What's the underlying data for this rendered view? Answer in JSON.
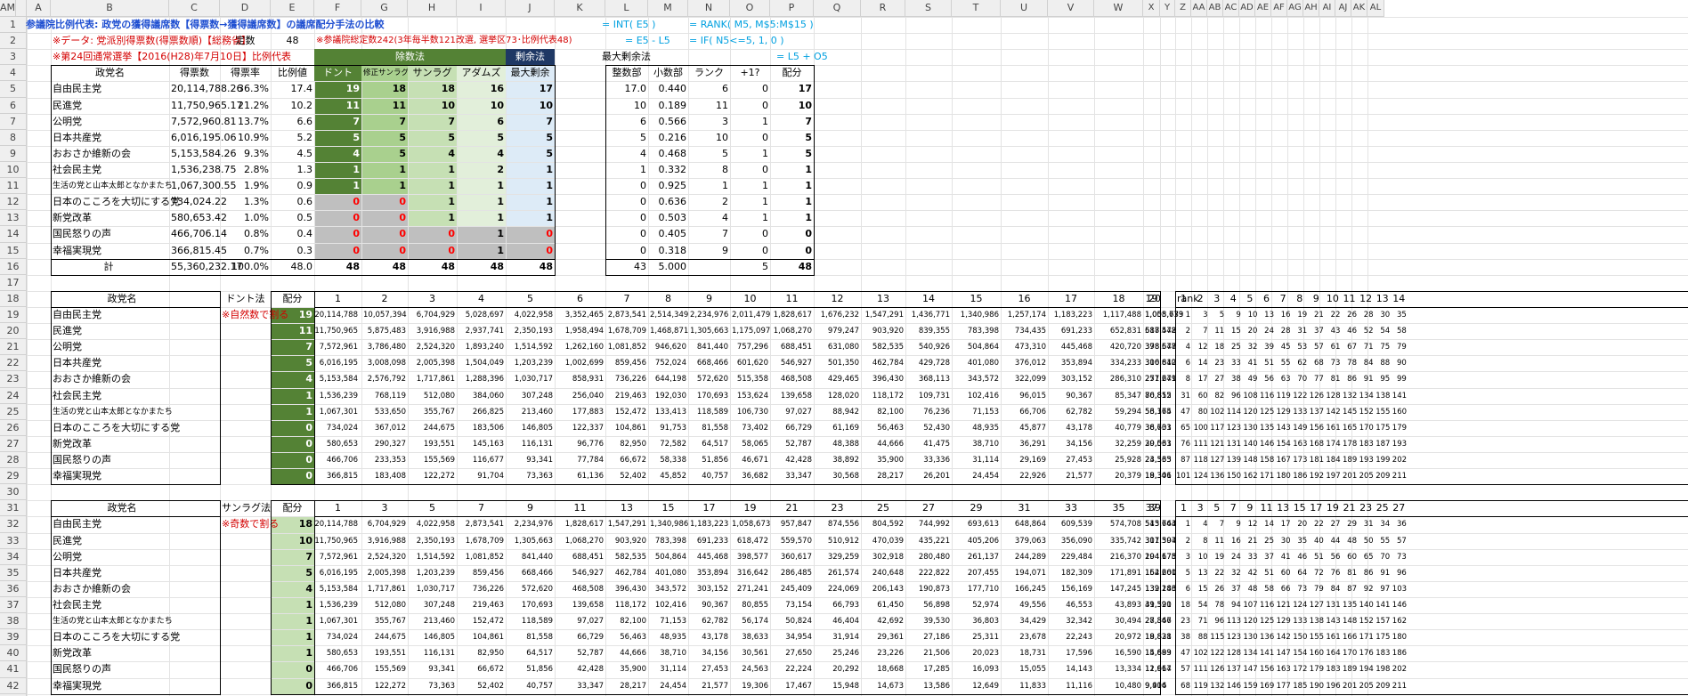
{
  "cols": [
    "A",
    "B",
    "C",
    "D",
    "E",
    "F",
    "G",
    "H",
    "I",
    "J",
    "K",
    "L",
    "M",
    "N",
    "O",
    "P",
    "Q",
    "R",
    "S",
    "T",
    "U",
    "V",
    "W",
    "X",
    "Y",
    "Z",
    "AA",
    "AB",
    "AC",
    "AD",
    "AE",
    "AF",
    "AG",
    "AH",
    "AI",
    "AJ",
    "AK",
    "AL",
    "AM"
  ],
  "title": "参議院比例代表: 政党の獲得議席数【得票数→獲得議席数】の議席配分手法の比較",
  "formula1": "= INT( E5 )",
  "formula2": "= RANK( M5, M$5:M$15 )",
  "formula3": "= E5 - L5",
  "formula4": "= IF( N5<=5, 1, 0 )",
  "formula5": "= L5 + O5",
  "note_data": "※データ: 党派別得票数(得票数順)【総務省】",
  "note_election": "※第24回通常選挙【2016(H28)年7月10日】比例代表",
  "note_seats": "※参議院総定数242(3年毎半数121改選, 選挙区73･比例代表48)",
  "label_teisu": "定数",
  "teisu": "48",
  "label_jyosu": "除数法",
  "label_jouyo": "剰余法",
  "label_saidai": "最大剰余法",
  "head1": [
    "政党名",
    "得票数",
    "得票率",
    "比例値",
    "ドント",
    "修正サンラグ",
    "サンラグ",
    "アダムズ",
    "最大剰余"
  ],
  "head2": [
    "整数部",
    "小数部",
    "ランク",
    "+1?",
    "配分"
  ],
  "parties": [
    "自由民主党",
    "民進党",
    "公明党",
    "日本共産党",
    "おおさか維新の会",
    "社会民主党",
    "生活の党と山本太郎となかまたち",
    "日本のこころを大切にする党",
    "新党改革",
    "国民怒りの声",
    "幸福実現党"
  ],
  "votes": [
    "20,114,788.26",
    "11,750,965.17",
    "7,572,960.81",
    "6,016,195.06",
    "5,153,584.26",
    "1,536,238.75",
    "1,067,300.55",
    "734,024.22",
    "580,653.42",
    "466,706.14",
    "366,815.45"
  ],
  "rate": [
    "36.3%",
    "21.2%",
    "13.7%",
    "10.9%",
    "9.3%",
    "2.8%",
    "1.9%",
    "1.3%",
    "1.0%",
    "0.8%",
    "0.7%"
  ],
  "hirei": [
    "17.4",
    "10.2",
    "6.6",
    "5.2",
    "4.5",
    "1.3",
    "0.9",
    "0.6",
    "0.5",
    "0.4",
    "0.3"
  ],
  "m_dhondt": [
    "19",
    "11",
    "7",
    "5",
    "4",
    "1",
    "1",
    "0",
    "0",
    "0",
    "0"
  ],
  "m_modsl": [
    "18",
    "11",
    "7",
    "5",
    "5",
    "1",
    "1",
    "0",
    "0",
    "0",
    "0"
  ],
  "m_sl": [
    "18",
    "10",
    "7",
    "5",
    "4",
    "1",
    "1",
    "1",
    "1",
    "0",
    "0"
  ],
  "m_adams": [
    "16",
    "10",
    "6",
    "5",
    "4",
    "2",
    "1",
    "1",
    "1",
    "1",
    "1"
  ],
  "m_lr": [
    "17",
    "10",
    "7",
    "5",
    "5",
    "1",
    "1",
    "1",
    "1",
    "0",
    "0"
  ],
  "lr_int": [
    "17.0",
    "10",
    "6",
    "5",
    "4",
    "1",
    "0",
    "0",
    "0",
    "0",
    "0"
  ],
  "lr_frac": [
    "0.440",
    "0.189",
    "0.566",
    "0.216",
    "0.468",
    "0.332",
    "0.925",
    "0.636",
    "0.503",
    "0.405",
    "0.318"
  ],
  "lr_rank": [
    "6",
    "11",
    "3",
    "10",
    "5",
    "8",
    "1",
    "2",
    "4",
    "7",
    "9"
  ],
  "lr_plus": [
    "0",
    "0",
    "1",
    "0",
    "1",
    "0",
    "1",
    "1",
    "1",
    "0",
    "0"
  ],
  "lr_alloc": [
    "17",
    "10",
    "7",
    "5",
    "5",
    "1",
    "1",
    "1",
    "1",
    "0",
    "0"
  ],
  "totals": {
    "label": "計",
    "votes": "55,360,232.17",
    "rate": "100.0%",
    "hirei": "48.0",
    "d": "48",
    "ms": "48",
    "s": "48",
    "a": "48",
    "lr": "48",
    "int": "43",
    "frac": "5.000",
    "plus": "5",
    "alloc": "48"
  },
  "sec2": {
    "head": [
      "政党名",
      "ドント法",
      "配分"
    ],
    "note": "※自然数で割る",
    "divs": [
      "1",
      "2",
      "3",
      "4",
      "5",
      "6",
      "7",
      "8",
      "9",
      "10",
      "11",
      "12",
      "13",
      "14",
      "15",
      "16",
      "17",
      "18",
      "19",
      "20"
    ],
    "alloc": [
      "19",
      "11",
      "7",
      "5",
      "4",
      "1",
      "1",
      "0",
      "0",
      "0",
      "0"
    ],
    "rows": [
      [
        "20,114,788",
        "10,057,394",
        "6,704,929",
        "5,028,697",
        "4,022,958",
        "3,352,465",
        "2,873,541",
        "2,514,349",
        "2,234,976",
        "2,011,479",
        "1,828,617",
        "1,676,232",
        "1,547,291",
        "1,436,771",
        "1,340,986",
        "1,257,174",
        "1,183,223",
        "1,117,488",
        "1,058,673",
        "1,005,739"
      ],
      [
        "11,750,965",
        "5,875,483",
        "3,916,988",
        "2,937,741",
        "2,350,193",
        "1,958,494",
        "1,678,709",
        "1,468,871",
        "1,305,663",
        "1,175,097",
        "1,068,270",
        "979,247",
        "903,920",
        "839,355",
        "783,398",
        "734,435",
        "691,233",
        "652,831",
        "618,472",
        "587,548"
      ],
      [
        "7,572,961",
        "3,786,480",
        "2,524,320",
        "1,893,240",
        "1,514,592",
        "1,262,160",
        "1,081,852",
        "946,620",
        "841,440",
        "757,296",
        "688,451",
        "631,080",
        "582,535",
        "540,926",
        "504,864",
        "473,310",
        "445,468",
        "420,720",
        "398,577",
        "378,648"
      ],
      [
        "6,016,195",
        "3,008,098",
        "2,005,398",
        "1,504,049",
        "1,203,239",
        "1,002,699",
        "859,456",
        "752,024",
        "668,466",
        "601,620",
        "546,927",
        "501,350",
        "462,784",
        "429,728",
        "401,080",
        "376,012",
        "353,894",
        "334,233",
        "316,642",
        "300,810"
      ],
      [
        "5,153,584",
        "2,576,792",
        "1,717,861",
        "1,288,396",
        "1,030,717",
        "858,931",
        "736,226",
        "644,198",
        "572,620",
        "515,358",
        "468,508",
        "429,465",
        "396,430",
        "368,113",
        "343,572",
        "322,099",
        "303,152",
        "286,310",
        "271,241",
        "257,679"
      ],
      [
        "1,536,239",
        "768,119",
        "512,080",
        "384,060",
        "307,248",
        "256,040",
        "219,463",
        "192,030",
        "170,693",
        "153,624",
        "139,658",
        "128,020",
        "118,172",
        "109,731",
        "102,416",
        "96,015",
        "90,367",
        "85,347",
        "80,855",
        "76,812"
      ],
      [
        "1,067,301",
        "533,650",
        "355,767",
        "266,825",
        "213,460",
        "177,883",
        "152,472",
        "133,413",
        "118,589",
        "106,730",
        "97,027",
        "88,942",
        "82,100",
        "76,236",
        "71,153",
        "66,706",
        "62,782",
        "59,294",
        "56,174",
        "53,365"
      ],
      [
        "734,024",
        "367,012",
        "244,675",
        "183,506",
        "146,805",
        "122,337",
        "104,861",
        "91,753",
        "81,558",
        "73,402",
        "66,729",
        "61,169",
        "56,463",
        "52,430",
        "48,935",
        "45,877",
        "43,178",
        "40,779",
        "38,633",
        "36,701"
      ],
      [
        "580,653",
        "290,327",
        "193,551",
        "145,163",
        "116,131",
        "96,776",
        "82,950",
        "72,582",
        "64,517",
        "58,065",
        "52,787",
        "48,388",
        "44,666",
        "41,475",
        "38,710",
        "36,291",
        "34,156",
        "32,259",
        "30,561",
        "29,033"
      ],
      [
        "466,706",
        "233,353",
        "155,569",
        "116,677",
        "93,341",
        "77,784",
        "66,672",
        "58,338",
        "51,856",
        "46,671",
        "42,428",
        "38,892",
        "35,900",
        "33,336",
        "31,114",
        "29,169",
        "27,453",
        "25,928",
        "24,563",
        "23,335"
      ],
      [
        "366,815",
        "183,408",
        "122,272",
        "91,704",
        "73,363",
        "61,136",
        "52,402",
        "45,852",
        "40,757",
        "36,682",
        "33,347",
        "30,568",
        "28,217",
        "26,201",
        "24,454",
        "22,926",
        "21,577",
        "20,379",
        "19,306",
        "18,341"
      ]
    ],
    "ranklabel": "rank",
    "rankhead": [
      "1",
      "2",
      "3",
      "4",
      "5",
      "6",
      "7",
      "8",
      "9",
      "10",
      "11",
      "12",
      "13",
      "14"
    ],
    "ranks": [
      [
        "1",
        "3",
        "5",
        "9",
        "10",
        "13",
        "16",
        "19",
        "21",
        "22",
        "26",
        "28",
        "30",
        "35"
      ],
      [
        "2",
        "7",
        "11",
        "15",
        "20",
        "24",
        "28",
        "31",
        "37",
        "43",
        "46",
        "52",
        "54",
        "58"
      ],
      [
        "4",
        "12",
        "18",
        "25",
        "32",
        "39",
        "45",
        "53",
        "57",
        "61",
        "67",
        "71",
        "75",
        "79"
      ],
      [
        "6",
        "14",
        "23",
        "33",
        "41",
        "51",
        "55",
        "62",
        "68",
        "73",
        "78",
        "84",
        "88",
        "90"
      ],
      [
        "8",
        "17",
        "27",
        "38",
        "49",
        "56",
        "63",
        "70",
        "77",
        "81",
        "86",
        "91",
        "95",
        "99"
      ],
      [
        "31",
        "60",
        "82",
        "96",
        "108",
        "116",
        "119",
        "122",
        "126",
        "128",
        "132",
        "134",
        "138",
        "141"
      ],
      [
        "47",
        "80",
        "102",
        "114",
        "120",
        "125",
        "129",
        "133",
        "137",
        "142",
        "145",
        "152",
        "155",
        "160"
      ],
      [
        "65",
        "100",
        "117",
        "123",
        "130",
        "135",
        "143",
        "149",
        "156",
        "161",
        "165",
        "170",
        "175",
        "179"
      ],
      [
        "76",
        "111",
        "121",
        "131",
        "140",
        "146",
        "154",
        "163",
        "168",
        "174",
        "178",
        "183",
        "187",
        "193"
      ],
      [
        "87",
        "118",
        "127",
        "139",
        "148",
        "158",
        "167",
        "173",
        "181",
        "184",
        "189",
        "193",
        "199",
        "202"
      ],
      [
        "101",
        "124",
        "136",
        "150",
        "162",
        "171",
        "180",
        "186",
        "192",
        "197",
        "201",
        "205",
        "209",
        "211"
      ]
    ]
  },
  "sec3": {
    "head": [
      "政党名",
      "サンラグ法",
      "配分"
    ],
    "note": "※奇数で割る",
    "divs": [
      "1",
      "3",
      "5",
      "7",
      "9",
      "11",
      "13",
      "15",
      "17",
      "19",
      "21",
      "23",
      "25",
      "27",
      "29",
      "31",
      "33",
      "35",
      "37",
      "39"
    ],
    "alloc": [
      "18",
      "10",
      "7",
      "5",
      "4",
      "1",
      "1",
      "1",
      "1",
      "0",
      "0"
    ],
    "rows": [
      [
        "20,114,788",
        "6,704,929",
        "4,022,958",
        "2,873,541",
        "2,234,976",
        "1,828,617",
        "1,547,291",
        "1,340,986",
        "1,183,223",
        "1,058,673",
        "957,847",
        "874,556",
        "804,592",
        "744,992",
        "693,613",
        "648,864",
        "609,539",
        "574,708",
        "543,643",
        "515,764"
      ],
      [
        "11,750,965",
        "3,916,988",
        "2,350,193",
        "1,678,709",
        "1,305,663",
        "1,068,270",
        "903,920",
        "783,398",
        "691,233",
        "618,472",
        "559,570",
        "510,912",
        "470,039",
        "435,221",
        "405,206",
        "379,063",
        "356,090",
        "335,742",
        "317,594",
        "301,307"
      ],
      [
        "7,572,961",
        "2,524,320",
        "1,514,592",
        "1,081,852",
        "841,440",
        "688,451",
        "582,535",
        "504,864",
        "445,468",
        "398,577",
        "360,617",
        "329,259",
        "302,918",
        "280,480",
        "261,137",
        "244,289",
        "229,484",
        "216,370",
        "204,675",
        "194,178"
      ],
      [
        "6,016,195",
        "2,005,398",
        "1,203,239",
        "859,456",
        "668,466",
        "546,927",
        "462,784",
        "401,080",
        "353,894",
        "316,642",
        "286,485",
        "261,574",
        "240,648",
        "222,822",
        "207,455",
        "194,071",
        "182,309",
        "171,891",
        "162,600",
        "154,261"
      ],
      [
        "5,153,584",
        "1,717,861",
        "1,030,717",
        "736,226",
        "572,620",
        "468,508",
        "396,430",
        "343,572",
        "303,152",
        "271,241",
        "245,409",
        "224,069",
        "206,143",
        "190,873",
        "177,710",
        "166,245",
        "156,169",
        "147,245",
        "139,286",
        "132,143"
      ],
      [
        "1,536,239",
        "512,080",
        "307,248",
        "219,463",
        "170,693",
        "139,658",
        "118,172",
        "102,416",
        "90,367",
        "80,855",
        "73,154",
        "66,793",
        "61,450",
        "56,898",
        "52,974",
        "49,556",
        "46,553",
        "43,893",
        "41,520",
        "39,391"
      ],
      [
        "1,067,301",
        "355,767",
        "213,460",
        "152,472",
        "118,589",
        "97,027",
        "82,100",
        "71,153",
        "62,782",
        "56,174",
        "50,824",
        "46,404",
        "42,692",
        "39,530",
        "36,803",
        "34,429",
        "32,342",
        "30,494",
        "28,846",
        "27,367"
      ],
      [
        "734,024",
        "244,675",
        "146,805",
        "104,861",
        "81,558",
        "66,729",
        "56,463",
        "48,935",
        "43,178",
        "38,633",
        "34,954",
        "31,914",
        "29,361",
        "27,186",
        "25,311",
        "23,678",
        "22,243",
        "20,972",
        "19,838",
        "18,821"
      ],
      [
        "580,653",
        "193,551",
        "116,131",
        "82,950",
        "64,517",
        "52,787",
        "44,666",
        "38,710",
        "34,156",
        "30,561",
        "27,650",
        "25,246",
        "23,226",
        "21,506",
        "20,023",
        "18,731",
        "17,596",
        "16,590",
        "15,693",
        "14,889"
      ],
      [
        "466,706",
        "155,569",
        "93,341",
        "66,672",
        "51,856",
        "42,428",
        "35,900",
        "31,114",
        "27,453",
        "24,563",
        "22,224",
        "20,292",
        "18,668",
        "17,285",
        "16,093",
        "15,055",
        "14,143",
        "13,334",
        "12,614",
        "11,967"
      ],
      [
        "366,815",
        "122,272",
        "73,363",
        "52,402",
        "40,757",
        "33,347",
        "28,217",
        "24,454",
        "21,577",
        "19,306",
        "17,467",
        "15,948",
        "14,673",
        "13,586",
        "12,649",
        "11,833",
        "11,116",
        "10,480",
        "9,914",
        "9,406"
      ]
    ],
    "rankhead": [
      "1",
      "3",
      "5",
      "7",
      "9",
      "11",
      "13",
      "15",
      "17",
      "19",
      "21",
      "23",
      "25",
      "27"
    ],
    "ranks": [
      [
        "1",
        "4",
        "7",
        "9",
        "12",
        "14",
        "17",
        "20",
        "22",
        "27",
        "29",
        "31",
        "34",
        "36"
      ],
      [
        "2",
        "8",
        "11",
        "16",
        "21",
        "25",
        "30",
        "35",
        "40",
        "44",
        "48",
        "50",
        "55",
        "57"
      ],
      [
        "3",
        "10",
        "19",
        "24",
        "33",
        "37",
        "41",
        "46",
        "51",
        "56",
        "60",
        "65",
        "70",
        "73"
      ],
      [
        "5",
        "13",
        "22",
        "32",
        "42",
        "51",
        "60",
        "64",
        "72",
        "76",
        "81",
        "86",
        "91",
        "96"
      ],
      [
        "6",
        "15",
        "26",
        "37",
        "48",
        "58",
        "66",
        "73",
        "79",
        "84",
        "87",
        "92",
        "97",
        "103"
      ],
      [
        "18",
        "54",
        "78",
        "94",
        "107",
        "116",
        "121",
        "124",
        "127",
        "131",
        "135",
        "140",
        "141",
        "146"
      ],
      [
        "23",
        "71",
        "96",
        "113",
        "120",
        "125",
        "129",
        "133",
        "138",
        "143",
        "148",
        "152",
        "157",
        "162"
      ],
      [
        "38",
        "88",
        "115",
        "123",
        "130",
        "136",
        "142",
        "150",
        "155",
        "161",
        "166",
        "171",
        "175",
        "180"
      ],
      [
        "47",
        "102",
        "122",
        "128",
        "134",
        "141",
        "147",
        "154",
        "160",
        "164",
        "170",
        "176",
        "183",
        "186"
      ],
      [
        "57",
        "111",
        "126",
        "137",
        "147",
        "156",
        "163",
        "172",
        "179",
        "183",
        "189",
        "194",
        "198",
        "202"
      ],
      [
        "68",
        "119",
        "132",
        "146",
        "159",
        "169",
        "177",
        "185",
        "190",
        "196",
        "201",
        "205",
        "209",
        "211"
      ]
    ]
  }
}
